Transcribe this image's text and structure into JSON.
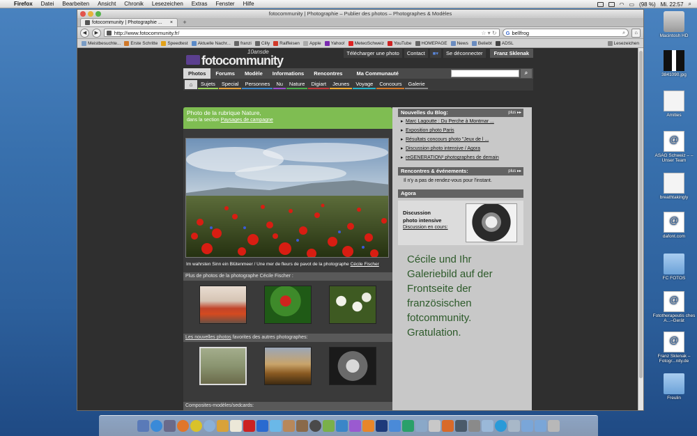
{
  "menubar": {
    "app": "Firefox",
    "items": [
      "Datei",
      "Bearbeiten",
      "Ansicht",
      "Chronik",
      "Lesezeichen",
      "Extras",
      "Fenster",
      "Hilfe"
    ],
    "battery": "(98 %)",
    "clock": "Mi. 22:57"
  },
  "browser": {
    "title": "fotocommunity | Photographie – Publier des photos – Photographes & Modèles",
    "tab_label": "fotocommunity | Photographie ...",
    "url": "http://www.fotocommunity.fr/",
    "search_value": "bellfrog",
    "bookmarks": [
      "Meistbesuchte...",
      "Erste Schritte",
      "Speedtest",
      "Aktuelle Nachr...",
      "franzi",
      "Cilly",
      "Raiffeisen",
      "Apple",
      "Yahoo!",
      "MeteoSchweiz",
      "YouTube",
      "HOMEPAGE",
      "News",
      "Beliebt",
      "ADSL",
      "Lesezeichen"
    ]
  },
  "site": {
    "logo": "fotocommunity",
    "logo_badge": "10ansde",
    "toplinks": [
      "Télécharger une photo",
      "Contact",
      "Se déconnecter"
    ],
    "user": "Franz Sklenak",
    "nav": [
      "Photos",
      "Forums",
      "Modèle",
      "Informations",
      "Rencontres",
      "Ma Communauté"
    ],
    "subnav": [
      "Sujets",
      "Special",
      "Personnes",
      "Nu",
      "Nature",
      "Digiart",
      "Jeunes",
      "Voyage",
      "Concours",
      "Galerie"
    ],
    "subnav_colors": [
      "#9bd35a",
      "#e4a23a",
      "#3b86c8",
      "#9a4fd0",
      "#4cae4c",
      "#c43c3c",
      "#f0a830",
      "#27b5c9",
      "#d47a2a",
      "#8a8a8a"
    ],
    "feature": {
      "line1": "Photo de la rubrique Nature,",
      "line2_prefix": "dans la section ",
      "line2_link": "Paysages de campagne"
    },
    "caption_text": "Im wahrsten Sinn ein Blütenmeer / Une mer de fleurs de pavot de la photographe ",
    "caption_link": "Cécile Fischer",
    "more_photos": "Plus de photos de la photographe Cécile Fischer :",
    "new_photos_link": "Les nouvelles photos",
    "new_photos_rest": " favorites des autres photographes:",
    "composites": "Composites-modèles/sedcards:",
    "blog_title": "Nouvelles du Blog:",
    "plus": "plus ▸▸",
    "blog_items": [
      "Marc Lagoutte : Du Perche à Montmar ...",
      "Exposition photo Paris",
      "Résultats concours photo \"Jeux de l ...",
      "Discussion photo intensive / Agora",
      "reGENERATION² photographes de demain"
    ],
    "events_title": "Rencontres & événements:",
    "events_text": "Il n'y a pas de rendez-vous pour l'instant.",
    "agora_title": "Agora",
    "agora_line1": "Discussion",
    "agora_line2": "photo intensive",
    "agora_link": "Discussion en cours:",
    "greeting": "Cécile und Ihr Galeriebild auf der Frontseite der französischen fotcommunity. Gratulation."
  },
  "desktop": [
    "Macintosh HD",
    "3841090.jpg",
    "Amities",
    "ASAG Schweiz – – Unser Team",
    "breathtakingly",
    "dafont.com",
    "FC FOTOS",
    "Fototherapeutis ches A...–Gerät",
    "Franz Sklenak – Fotogr...nity.de",
    "Freulin"
  ]
}
